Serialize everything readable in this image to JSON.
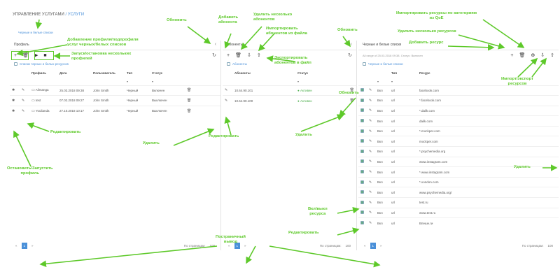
{
  "breadcrumb": {
    "part1": "УПРАВЛЕНИЕ УСЛУГАМИ",
    "sep": " / ",
    "part2": "УСЛУГИ"
  },
  "subtitle": "Черные и белые списки",
  "panel1": {
    "title": "Профиль",
    "add_icon": "+",
    "delete_icon": "🗑",
    "play_icon": "▶",
    "stop_icon": "■",
    "refresh_icon": "↻",
    "link_text": "Списки черных и белых ресурсов",
    "columns": [
      "",
      "",
      "Профиль",
      "Дата",
      "Пользователь",
      "Тип",
      "Статус",
      ""
    ],
    "rows": [
      {
        "profile": "Alimanga",
        "date": "25.03.2018 09:38",
        "user": "John Smith",
        "type": "Черный",
        "status": "Включен"
      },
      {
        "profile": "test",
        "date": "07.02.2018 09:27",
        "user": "John Smith",
        "type": "Черный",
        "status": "Выключен"
      },
      {
        "profile": "Youlianda",
        "date": "27.10.2018 10:17",
        "user": "John Smith",
        "type": "Черный",
        "status": "Выключен"
      }
    ],
    "pager": {
      "prev": "«",
      "page": "1",
      "next": "»",
      "per_page_label": "По страницам:",
      "per_page": "100"
    }
  },
  "panel2": {
    "title": "Абоненты",
    "add_icon": "+",
    "delete_icon": "🗑",
    "import_icon": "⇩",
    "export_icon": "⇧",
    "refresh_icon": "↻",
    "link_text": "Абоненты",
    "columns": [
      "Абоненты",
      "Статус"
    ],
    "rows": [
      {
        "subscriber": "10.64.90.101",
        "status": "Активен"
      },
      {
        "subscriber": "10.64.90.100",
        "status": "Активен"
      }
    ],
    "pager": {
      "prev": "«",
      "page": "1",
      "next": "»",
      "per_page_label": "По страницам:",
      "per_page": "100"
    }
  },
  "panel3": {
    "title": "Черные и белые списки",
    "info": "All range of 25.03.2018 09:38. Статус: Включен",
    "add_icon": "+",
    "delete_icon": "🗑",
    "categories_icon": "⊕",
    "import_icon": "⇩",
    "export_icon": "⇧",
    "link_text": "Черные и белые списки",
    "columns": [
      "",
      "",
      "",
      "Тип",
      "Ресурс"
    ],
    "rows": [
      {
        "state": "Вкл",
        "type": "url",
        "resource": "facebook.com"
      },
      {
        "state": "Вкл",
        "type": "url",
        "resource": "*.facebook.com"
      },
      {
        "state": "Вкл",
        "type": "url",
        "resource": "*.dailk.com"
      },
      {
        "state": "Вкл",
        "type": "url",
        "resource": "dailk.com"
      },
      {
        "state": "Вкл",
        "type": "url",
        "resource": "*.mockper.com"
      },
      {
        "state": "Вкл",
        "type": "url",
        "resource": "mockper.com"
      },
      {
        "state": "Вкл",
        "type": "url",
        "resource": "*.psychemedia.org"
      },
      {
        "state": "Вкл",
        "type": "url",
        "resource": "www.instagram.com"
      },
      {
        "state": "Вкл",
        "type": "url",
        "resource": "*.www.instagram.com"
      },
      {
        "state": "Вкл",
        "type": "url",
        "resource": "*.xondon.com"
      },
      {
        "state": "Вкл",
        "type": "url",
        "resource": "www.psychemedia.org/"
      },
      {
        "state": "Вкл",
        "type": "url",
        "resource": "test.ru"
      },
      {
        "state": "Вкл",
        "type": "url",
        "resource": "www.test.ru"
      },
      {
        "state": "Вкл",
        "type": "url",
        "resource": "Впешн.ги"
      }
    ],
    "pager": {
      "prev": "«",
      "page": "1",
      "next": "»",
      "per_page_label": "По страницам:",
      "per_page": "100"
    }
  },
  "annotations": {
    "refresh1": "Обновить",
    "add_subscriber": "Добавить\nабонента",
    "delete_several_subs": "Удалить несколько\nабонентов",
    "import_subs": "Импортировать\nабонентов из файла",
    "refresh2": "Обновить",
    "import_by_cat": "Импортировать ресурсы по категориям\nиз QoE",
    "delete_several_res": "Удалить несколько ресурсов",
    "add_resource": "Добавить ресурс",
    "add_profile": "Добавление профиля/подпрофиля\nуслуг черных/белых списков",
    "start_stop": "Запуск/остановка нескольких\nпрофилей",
    "export_subs": "Экспортировать\nабонентов в файл",
    "import_export_res": "Импорт/экспорт\nресурсов",
    "refresh3": "Обновить",
    "edit1": "Редактировать",
    "delete1": "Удалить",
    "edit2": "Редактировать",
    "delete2": "Удалить",
    "stop_start_profile": "Остановить/Запустить\nпрофиль",
    "delete3": "Удалить",
    "on_off_res": "Вкл/выкл\nресурса",
    "edit3": "Редактировать",
    "pagination": "Постраничный\nвывод"
  },
  "colors": {
    "annotation": "#5ec92a",
    "accent": "#4a90d9",
    "status_active": "#4cae4c"
  }
}
